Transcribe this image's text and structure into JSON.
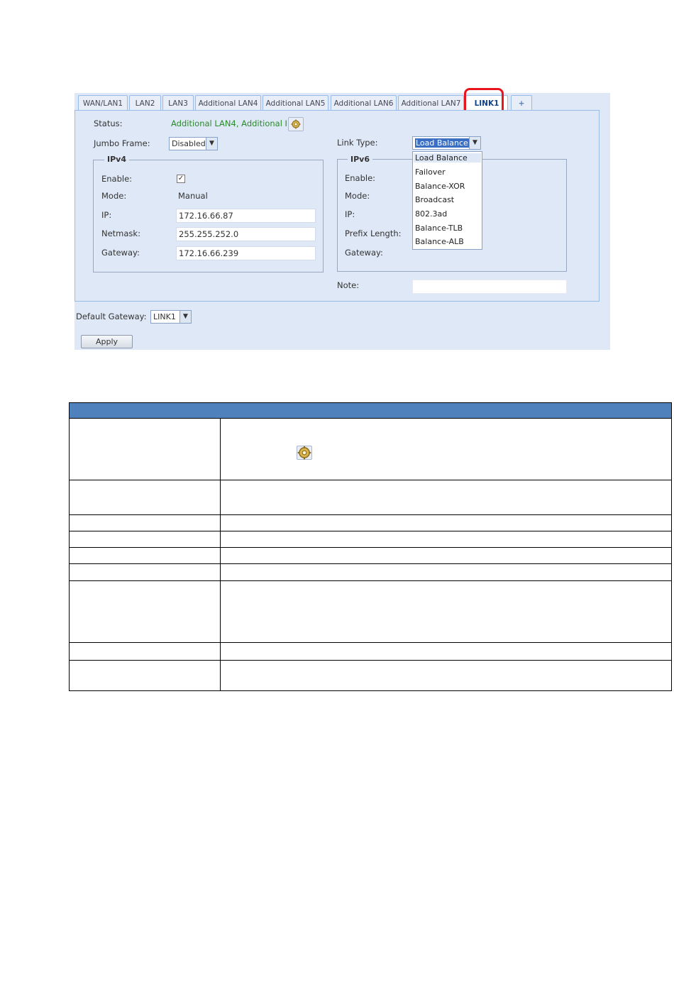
{
  "tabs": [
    {
      "label": "WAN/LAN1"
    },
    {
      "label": "LAN2"
    },
    {
      "label": "LAN3"
    },
    {
      "label": "Additional LAN4"
    },
    {
      "label": "Additional LAN5"
    },
    {
      "label": "Additional LAN6"
    },
    {
      "label": "Additional LAN7"
    },
    {
      "label": "LINK1"
    },
    {
      "label": "+"
    }
  ],
  "status": {
    "label": "Status:",
    "value": "Additional LAN4, Additional I"
  },
  "jumbo_frame": {
    "label": "Jumbo Frame:",
    "value": "Disabled"
  },
  "link_type": {
    "label": "Link Type:",
    "value": "Load Balance",
    "options": [
      "Load Balance",
      "Failover",
      "Balance-XOR",
      "Broadcast",
      "802.3ad",
      "Balance-TLB",
      "Balance-ALB"
    ]
  },
  "ipv4": {
    "legend": "IPv4",
    "enable_label": "Enable:",
    "enable_checked": "✓",
    "mode_label": "Mode:",
    "mode_value": "Manual",
    "ip_label": "IP:",
    "ip_value": "172.16.66.87",
    "netmask_label": "Netmask:",
    "netmask_value": "255.255.252.0",
    "gateway_label": "Gateway:",
    "gateway_value": "172.16.66.239"
  },
  "ipv6": {
    "legend": "IPv6",
    "enable_label": "Enable:",
    "mode_label": "Mode:",
    "ip_label": "IP:",
    "prefix_label": "Prefix Length:",
    "gateway_label": "Gateway:"
  },
  "note": {
    "label": "Note:",
    "value": ""
  },
  "default_gateway": {
    "label": "Default Gateway:",
    "value": "LINK1"
  },
  "apply_label": "Apply",
  "icons": {
    "settings": "settings-gear-icon",
    "dropdown": "chevron-down-icon",
    "add_tab": "plus-icon"
  },
  "colors": {
    "highlight": "#e8141e",
    "table_header": "#4f81bd",
    "status_text": "#2b8a2b"
  }
}
